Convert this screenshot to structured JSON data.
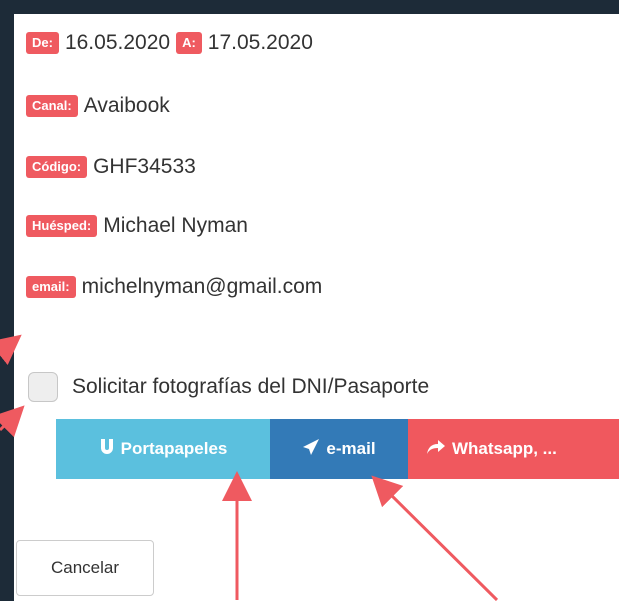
{
  "dates": {
    "from_label": "De:",
    "from_value": "16.05.2020",
    "to_label": "A:",
    "to_value": "17.05.2020"
  },
  "canal": {
    "label": "Canal:",
    "value": "Avaibook"
  },
  "codigo": {
    "label": "Código:",
    "value": "GHF34533"
  },
  "huesped": {
    "label": "Huésped:",
    "value": "Michael Nyman"
  },
  "email": {
    "label": "email:",
    "value": "michelnyman@gmail.com"
  },
  "checkbox": {
    "label": "Solicitar fotografías del DNI/Pasaporte"
  },
  "buttons": {
    "clipboard": "Portapapeles",
    "email": "e-mail",
    "whatsapp": "Whatsapp, ..."
  },
  "cancel_label": "Cancelar",
  "colors": {
    "badge": "#ef5a60",
    "clipboard": "#5bc0de",
    "email": "#337ab7",
    "whatsapp": "#f0585e",
    "background": "#1d2b38"
  },
  "icons": {
    "clipboard": "magnet-icon",
    "email": "paper-plane-icon",
    "whatsapp": "share-arrow-icon"
  }
}
